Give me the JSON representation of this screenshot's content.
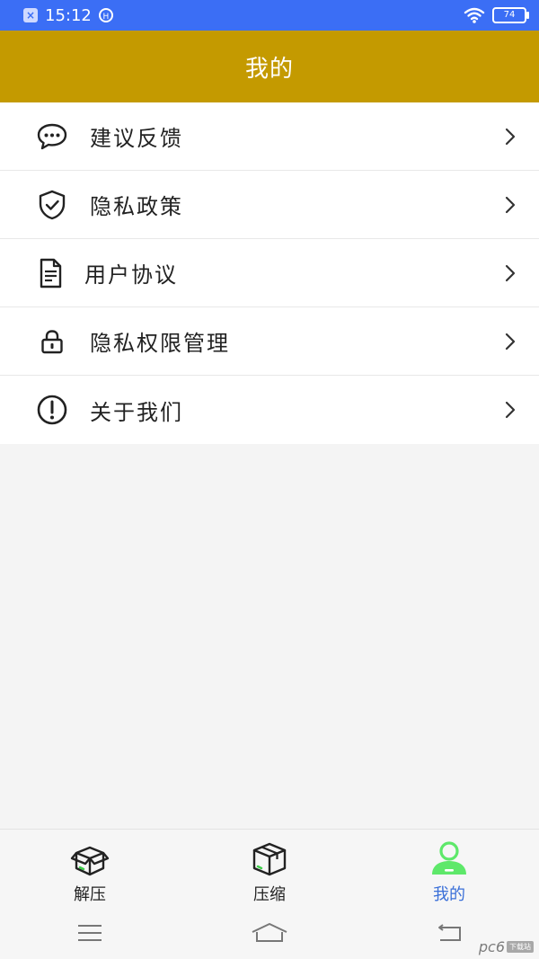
{
  "status_bar": {
    "time": "15:12",
    "battery": "74",
    "icons": [
      "notification-close-icon",
      "hd-icon",
      "wifi-icon",
      "battery-icon"
    ]
  },
  "header": {
    "title": "我的"
  },
  "menu": {
    "items": [
      {
        "label": "建议反馈",
        "icon": "chat-bubble-icon"
      },
      {
        "label": "隐私政策",
        "icon": "shield-check-icon"
      },
      {
        "label": "用户协议",
        "icon": "document-icon"
      },
      {
        "label": "隐私权限管理",
        "icon": "lock-icon"
      },
      {
        "label": "关于我们",
        "icon": "exclamation-circle-icon"
      }
    ]
  },
  "tabbar": {
    "tabs": [
      {
        "label": "解压",
        "icon": "open-box-icon",
        "active": false
      },
      {
        "label": "压缩",
        "icon": "closed-box-icon",
        "active": false
      },
      {
        "label": "我的",
        "icon": "user-icon",
        "active": true
      }
    ]
  },
  "watermark": {
    "brand": "pc6",
    "badge": "下载站"
  },
  "colors": {
    "status_bar": "#3b6ef5",
    "header": "#c49a00",
    "active_tab_text": "#3a6fd8",
    "active_tab_icon": "#5ee86a",
    "tab_accent": "#3fcf4b"
  }
}
